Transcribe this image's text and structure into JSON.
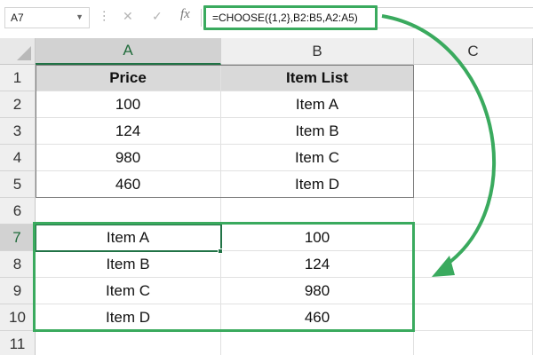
{
  "name_box": {
    "value": "A7"
  },
  "formula_bar": {
    "cancel_icon": "x-icon",
    "enter_icon": "check-icon",
    "function_label": "fx",
    "formula": "=CHOOSE({1,2},B2:B5,A2:A5)"
  },
  "columns": [
    "A",
    "B",
    "C"
  ],
  "selected_column": "A",
  "rows": [
    "1",
    "2",
    "3",
    "4",
    "5",
    "6",
    "7",
    "8",
    "9",
    "10",
    "11"
  ],
  "selected_row": "7",
  "source_table": {
    "headers": [
      "Price",
      "Item List"
    ],
    "rows": [
      [
        "100",
        "Item A"
      ],
      [
        "124",
        "Item B"
      ],
      [
        "980",
        "Item C"
      ],
      [
        "460",
        "Item D"
      ]
    ]
  },
  "result_range": {
    "rows": [
      [
        "Item A",
        "100"
      ],
      [
        "Item B",
        "124"
      ],
      [
        "Item C",
        "980"
      ],
      [
        "Item D",
        "460"
      ]
    ]
  },
  "colors": {
    "highlight": "#3aaa5e",
    "selection": "#217346",
    "header_fill": "#d9d9d9"
  }
}
